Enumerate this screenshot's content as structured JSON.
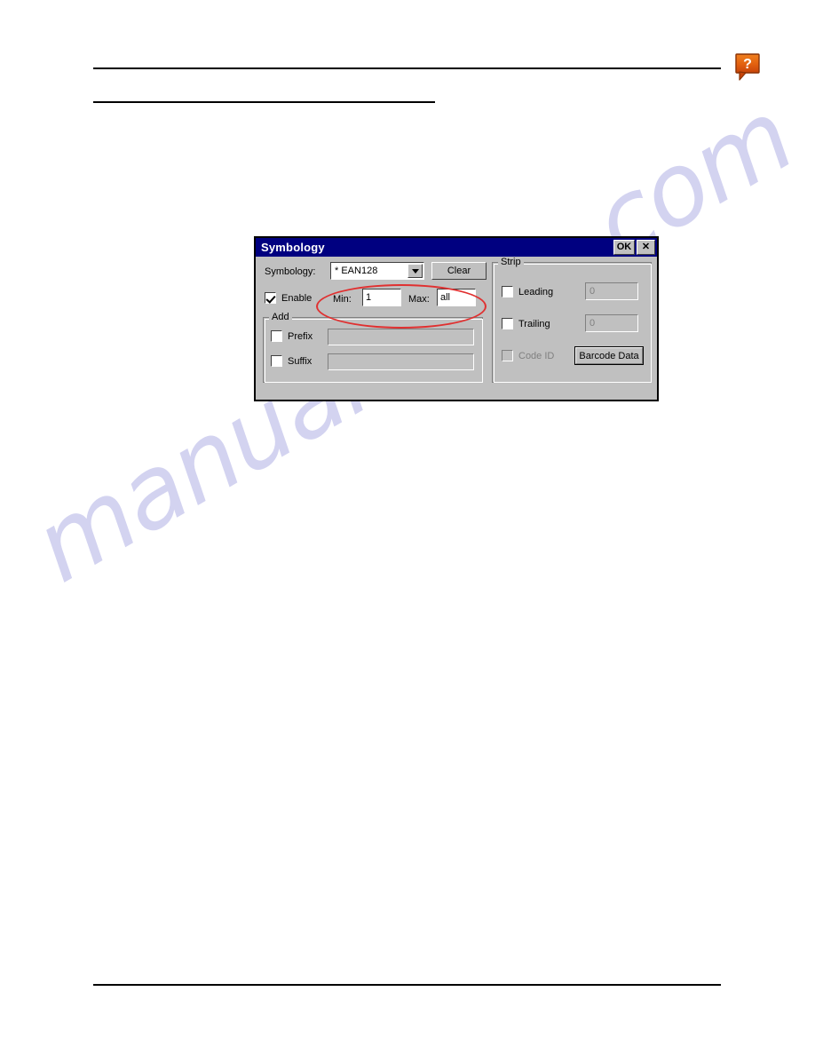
{
  "page": {
    "background_color": "#ffffff",
    "rule_color": "#000000",
    "watermark_text": "manualshive.com",
    "watermark_color": "#b9b9e8"
  },
  "header": {
    "help_icon": "help-question-callout-icon",
    "help_icon_color": "#e8601c",
    "help_icon_glyph": "?"
  },
  "annotation": {
    "shape": "ellipse",
    "color": "#e03030"
  },
  "dialog": {
    "title": "Symbology",
    "title_bar_color": "#000080",
    "face_color": "#c0c0c0",
    "buttons": {
      "ok": "OK",
      "close": "✕"
    },
    "symbology_label": "Symbology:",
    "symbology_value": "* EAN128",
    "clear_button": "Clear",
    "enable_label": "Enable",
    "enable_checked": true,
    "min_label": "Min:",
    "min_value": "1",
    "max_label": "Max:",
    "max_value": "all",
    "add_group": {
      "legend": "Add",
      "prefix_label": "Prefix",
      "prefix_checked": false,
      "prefix_value": "",
      "suffix_label": "Suffix",
      "suffix_checked": false,
      "suffix_value": ""
    },
    "strip_group": {
      "legend": "Strip",
      "leading_label": "Leading",
      "leading_checked": false,
      "leading_value": "0",
      "trailing_label": "Trailing",
      "trailing_checked": false,
      "trailing_value": "0",
      "code_id_label": "Code ID",
      "code_id_checked": false,
      "code_id_disabled": true,
      "barcode_data_button": "Barcode Data"
    }
  }
}
